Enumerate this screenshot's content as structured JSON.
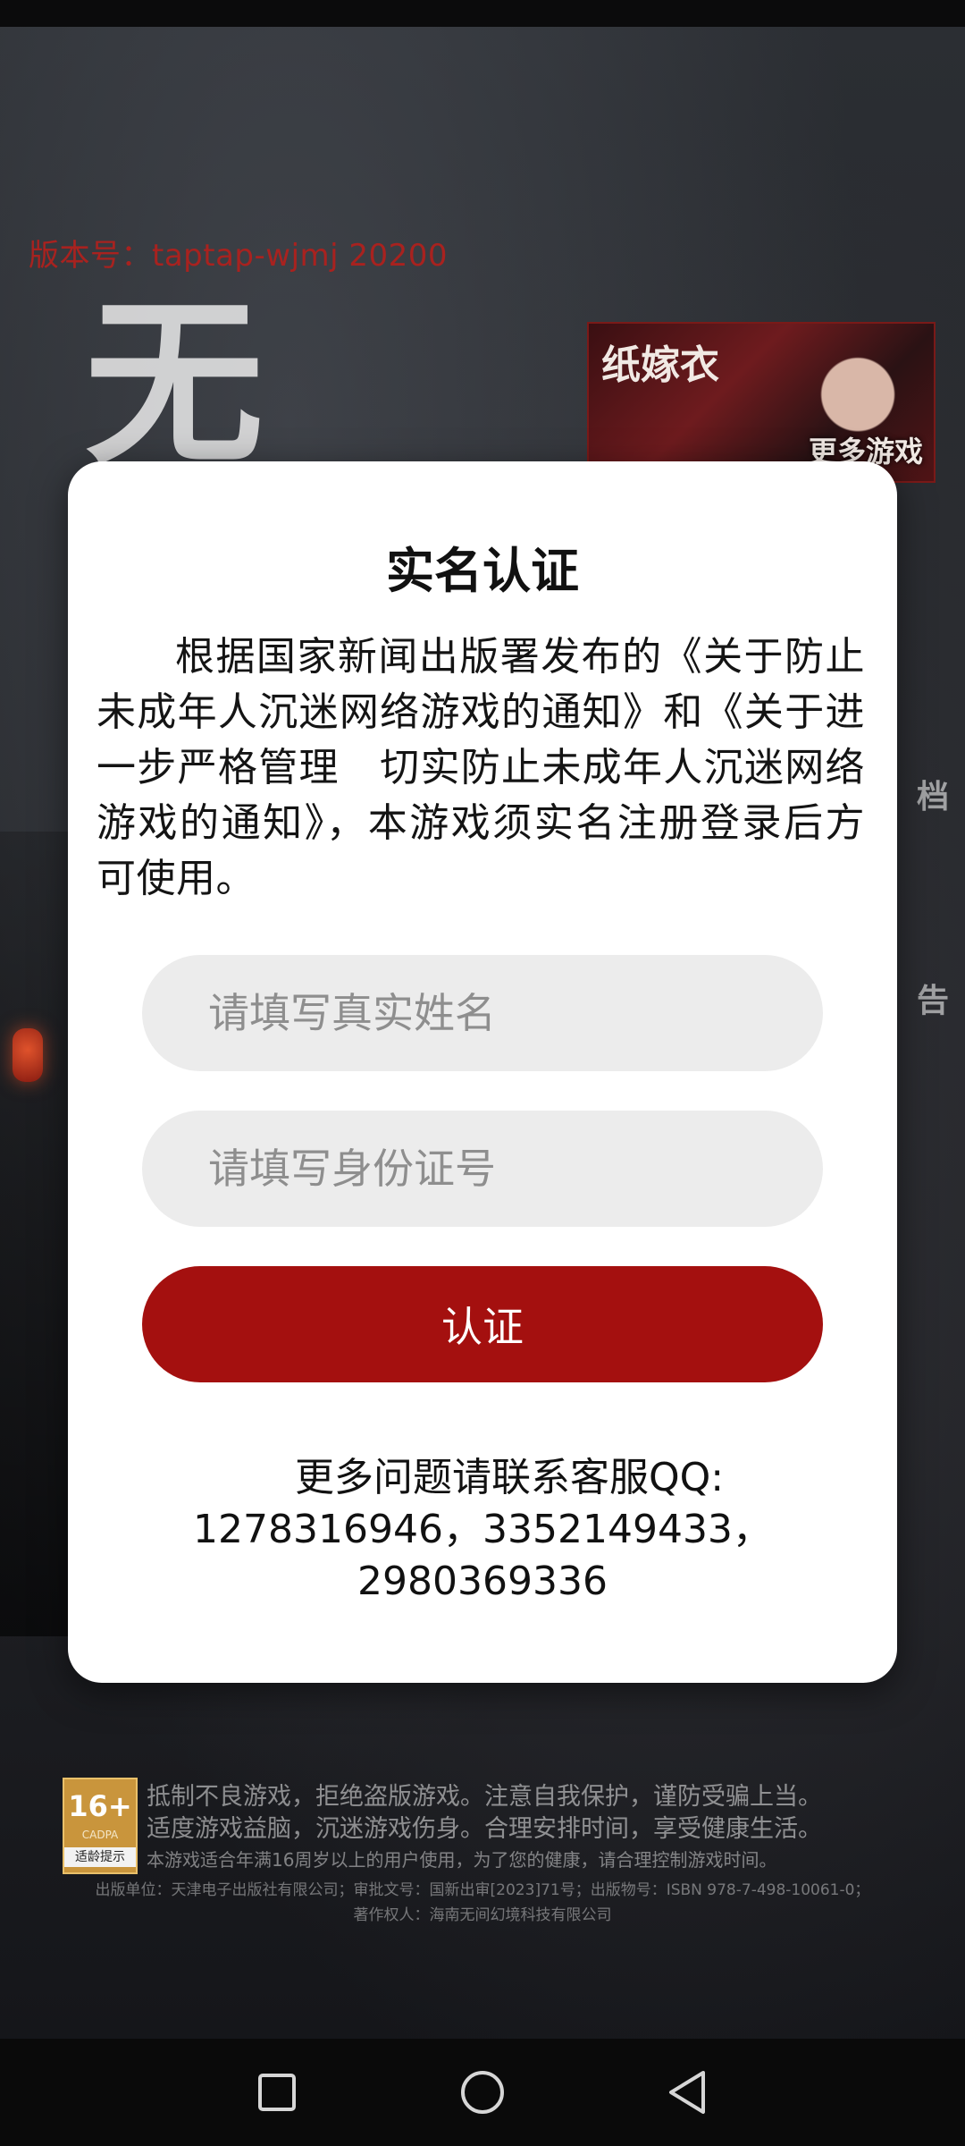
{
  "background": {
    "version_text": "版本号：taptap-wjmj 20200",
    "title_art_text": "无",
    "promo": {
      "title": "纸嫁衣",
      "more_label": "更多游戏"
    },
    "side_labels": [
      "档",
      "告"
    ]
  },
  "modal": {
    "title": "实名认证",
    "body": "根据国家新闻出版署发布的《关于防止未成年人沉迷网络游戏的通知》和《关于进一步严格管理　切实防止未成年人沉迷网络游戏的通知》，本游戏须实名注册登录后方可使用。",
    "name_placeholder": "请填写真实姓名",
    "id_placeholder": "请填写身份证号",
    "verify_label": "认证",
    "contact_line1": "更多问题请联系客服QQ:",
    "contact_line2": "1278316946，3352149433，",
    "contact_line3": "2980369336"
  },
  "footer": {
    "age_badge": {
      "rating": "16+",
      "org": "CADPA",
      "tip": "适龄提示"
    },
    "notice_line1": "抵制不良游戏，拒绝盗版游戏。注意自我保护，谨防受骗上当。",
    "notice_line2": "适度游戏益脑，沉迷游戏伤身。合理安排时间，享受健康生活。",
    "notice_line3": "本游戏适合年满16周岁以上的用户使用，为了您的健康，请合理控制游戏时间。",
    "publisher_line": "出版单位：天津电子出版社有限公司；审批文号：国新出审[2023]71号；出版物号：ISBN 978-7-498-10061-0；",
    "copyright_line": "著作权人：海南无间幻境科技有限公司"
  },
  "colors": {
    "accent": "#a4100f",
    "version_text": "#a8221f",
    "field_bg": "#ececec"
  },
  "navbar": {
    "icons": [
      "square-recent-icon",
      "circle-home-icon",
      "triangle-back-icon"
    ]
  }
}
